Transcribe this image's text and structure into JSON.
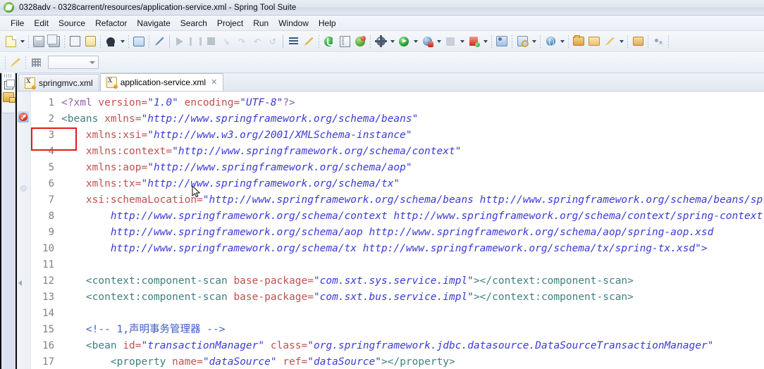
{
  "window": {
    "title": "0328adv - 0328carrent/resources/application-service.xml - Spring Tool Suite",
    "app_icon": "spring-leaf-icon"
  },
  "menu": {
    "items": [
      {
        "label": "File"
      },
      {
        "label": "Edit"
      },
      {
        "label": "Source"
      },
      {
        "label": "Refactor"
      },
      {
        "label": "Navigate"
      },
      {
        "label": "Search"
      },
      {
        "label": "Project"
      },
      {
        "label": "Run"
      },
      {
        "label": "Window"
      },
      {
        "label": "Help"
      }
    ]
  },
  "toolbar": {
    "groups": [
      {
        "buttons": [
          {
            "icon": "new-document-icon",
            "dropdown": true
          },
          {
            "icon": "save-icon",
            "dropdown": false
          },
          {
            "icon": "save-all-icon",
            "dropdown": false
          }
        ]
      },
      {
        "buttons": [
          {
            "icon": "print-icon",
            "dropdown": false
          },
          {
            "icon": "refresh-icon",
            "dropdown": false
          }
        ]
      },
      {
        "buttons": [
          {
            "icon": "person-icon",
            "dropdown": true
          }
        ]
      },
      {
        "buttons": [
          {
            "icon": "comment-icon",
            "dropdown": false
          }
        ]
      },
      {
        "buttons": [
          {
            "icon": "pen-strike-icon",
            "dropdown": false
          }
        ]
      },
      {
        "buttons": [
          {
            "icon": "resume-icon",
            "dropdown": false
          },
          {
            "icon": "suspend-icon",
            "dropdown": false
          },
          {
            "icon": "terminate-icon",
            "dropdown": false
          },
          {
            "icon": "step-into-icon",
            "dropdown": false
          },
          {
            "icon": "step-over-icon",
            "dropdown": false
          },
          {
            "icon": "step-return-icon",
            "dropdown": false
          },
          {
            "icon": "drop-to-frame-icon",
            "dropdown": false
          }
        ]
      },
      {
        "buttons": [
          {
            "icon": "list-icon",
            "dropdown": false
          },
          {
            "icon": "arrow-key-icon",
            "dropdown": false
          }
        ]
      },
      {
        "buttons": [
          {
            "icon": "green-record-icon",
            "dropdown": false
          },
          {
            "icon": "open-perspective-icon",
            "dropdown": false
          },
          {
            "icon": "spring-dashboard-icon",
            "dropdown": false
          }
        ]
      },
      {
        "buttons": [
          {
            "icon": "build-gear-icon",
            "dropdown": true
          },
          {
            "icon": "run-icon",
            "dropdown": true
          },
          {
            "icon": "debug-icon",
            "dropdown": true
          },
          {
            "icon": "external-tools-icon",
            "dropdown": true
          },
          {
            "icon": "run-server-icon",
            "dropdown": true
          }
        ]
      },
      {
        "buttons": [
          {
            "icon": "team-sync-icon",
            "dropdown": false
          }
        ]
      },
      {
        "buttons": [
          {
            "icon": "search-resource-icon",
            "dropdown": true
          }
        ]
      },
      {
        "buttons": [
          {
            "icon": "open-web-icon",
            "dropdown": true
          }
        ]
      },
      {
        "buttons": [
          {
            "icon": "open-type-icon",
            "dropdown": false
          },
          {
            "icon": "open-folder-icon",
            "dropdown": false
          },
          {
            "icon": "quick-fix-icon",
            "dropdown": true
          }
        ]
      },
      {
        "buttons": [
          {
            "icon": "package-icon",
            "dropdown": false
          }
        ]
      },
      {
        "buttons": [
          {
            "icon": "more-icon",
            "dropdown": false
          }
        ]
      }
    ]
  },
  "toolbar2": {
    "buttons": [
      {
        "icon": "pencil-icon"
      },
      {
        "icon": "numpad-icon"
      }
    ],
    "combo": {
      "value": "",
      "icon": "chevron-down-icon"
    }
  },
  "leftbar": {
    "restore_icon": "restore-view-icon",
    "package_explorer_icon": "package-explorer-icon"
  },
  "editor": {
    "tabs": [
      {
        "label": "springmvc.xml",
        "icon": "xml-file-icon",
        "active": false,
        "closable": false
      },
      {
        "label": "application-service.xml",
        "icon": "xml-file-icon",
        "active": true,
        "closable": true,
        "close_glyph": "✕"
      }
    ],
    "line_numbers": [
      1,
      2,
      3,
      4,
      5,
      6,
      7,
      8,
      9,
      10,
      11,
      12,
      13,
      14,
      15,
      16,
      17
    ],
    "error_marker": {
      "line": 2,
      "icon": "error-marker-icon"
    },
    "annotation": {
      "type": "red-rectangle",
      "color": "#e01b1b",
      "target": "error-marker-line-2"
    },
    "lines": [
      [
        {
          "t": "<?xml ",
          "c": "t-pi"
        },
        {
          "t": "version=",
          "c": "t-attr"
        },
        {
          "t": "\"1.0\"",
          "c": "t-val"
        },
        {
          "t": " ",
          "c": "t-plain"
        },
        {
          "t": "encoding=",
          "c": "t-attr"
        },
        {
          "t": "\"UTF-8\"",
          "c": "t-val"
        },
        {
          "t": "?>",
          "c": "t-pi"
        }
      ],
      [
        {
          "t": "<beans ",
          "c": "t-tag"
        },
        {
          "t": "xmlns=",
          "c": "t-attr"
        },
        {
          "t": "\"http://www.springframework.org/schema/beans\"",
          "c": "t-val"
        }
      ],
      [
        {
          "t": "    ",
          "c": "t-plain"
        },
        {
          "t": "xmlns:xsi=",
          "c": "t-attr"
        },
        {
          "t": "\"http://www.w3.org/2001/XMLSchema-instance\"",
          "c": "t-val"
        }
      ],
      [
        {
          "t": "    ",
          "c": "t-plain"
        },
        {
          "t": "xmlns:context=",
          "c": "t-attr"
        },
        {
          "t": "\"http://www.springframework.org/schema/context\"",
          "c": "t-val"
        }
      ],
      [
        {
          "t": "    ",
          "c": "t-plain"
        },
        {
          "t": "xmlns:aop=",
          "c": "t-attr"
        },
        {
          "t": "\"http://www.springframework.org/schema/aop\"",
          "c": "t-val"
        }
      ],
      [
        {
          "t": "    ",
          "c": "t-plain"
        },
        {
          "t": "xmlns:tx=",
          "c": "t-attr"
        },
        {
          "t": "\"http://www.springframework.org/schema/tx\"",
          "c": "t-val"
        }
      ],
      [
        {
          "t": "    ",
          "c": "t-plain"
        },
        {
          "t": "xsi:schemaLocation=",
          "c": "t-attr"
        },
        {
          "t": "\"http://www.springframework.org/schema/beans http://www.springframework.org/schema/beans/spring-beans.xsd",
          "c": "t-val"
        }
      ],
      [
        {
          "t": "        http://www.springframework.org/schema/context http://www.springframework.org/schema/context/spring-context.xsd",
          "c": "t-val"
        }
      ],
      [
        {
          "t": "        http://www.springframework.org/schema/aop http://www.springframework.org/schema/aop/spring-aop.xsd",
          "c": "t-val"
        }
      ],
      [
        {
          "t": "        http://www.springframework.org/schema/tx http://www.springframework.org/schema/tx/spring-tx.xsd\">",
          "c": "t-val"
        }
      ],
      [],
      [
        {
          "t": "    ",
          "c": "t-plain"
        },
        {
          "t": "<context:component-scan ",
          "c": "t-tag"
        },
        {
          "t": "base-package=",
          "c": "t-attr"
        },
        {
          "t": "\"com.sxt.sys.service.impl\"",
          "c": "t-val"
        },
        {
          "t": "></context:component-scan>",
          "c": "t-tag"
        }
      ],
      [
        {
          "t": "    ",
          "c": "t-plain"
        },
        {
          "t": "<context:component-scan ",
          "c": "t-tag"
        },
        {
          "t": "base-package=",
          "c": "t-attr"
        },
        {
          "t": "\"com.sxt.bus.service.impl\"",
          "c": "t-val"
        },
        {
          "t": "></context:component-scan>",
          "c": "t-tag"
        }
      ],
      [],
      [
        {
          "t": "    ",
          "c": "t-plain"
        },
        {
          "t": "<!-- 1,声明事务管理器 -->",
          "c": "t-comment"
        }
      ],
      [
        {
          "t": "    ",
          "c": "t-plain"
        },
        {
          "t": "<bean ",
          "c": "t-tag"
        },
        {
          "t": "id=",
          "c": "t-attr"
        },
        {
          "t": "\"transactionManager\"",
          "c": "t-val"
        },
        {
          "t": " ",
          "c": "t-plain"
        },
        {
          "t": "class=",
          "c": "t-attr"
        },
        {
          "t": "\"org.springframework.jdbc.datasource.DataSourceTransactionManager\"",
          "c": "t-val"
        }
      ],
      [
        {
          "t": "        ",
          "c": "t-plain"
        },
        {
          "t": "<property ",
          "c": "t-tag"
        },
        {
          "t": "name=",
          "c": "t-attr"
        },
        {
          "t": "\"dataSource\"",
          "c": "t-val"
        },
        {
          "t": " ",
          "c": "t-plain"
        },
        {
          "t": "ref=",
          "c": "t-attr"
        },
        {
          "t": "\"dataSource\"",
          "c": "t-val"
        },
        {
          "t": "></property>",
          "c": "t-tag"
        }
      ]
    ]
  },
  "colors": {
    "annotation_red": "#e01b1b",
    "string_value": "#3a3ad6",
    "attribute": "#c05050",
    "tag": "#3f7f7f",
    "comment": "#3f5fbf",
    "processing_instruction": "#8f5fa8",
    "line_number": "#808080"
  }
}
